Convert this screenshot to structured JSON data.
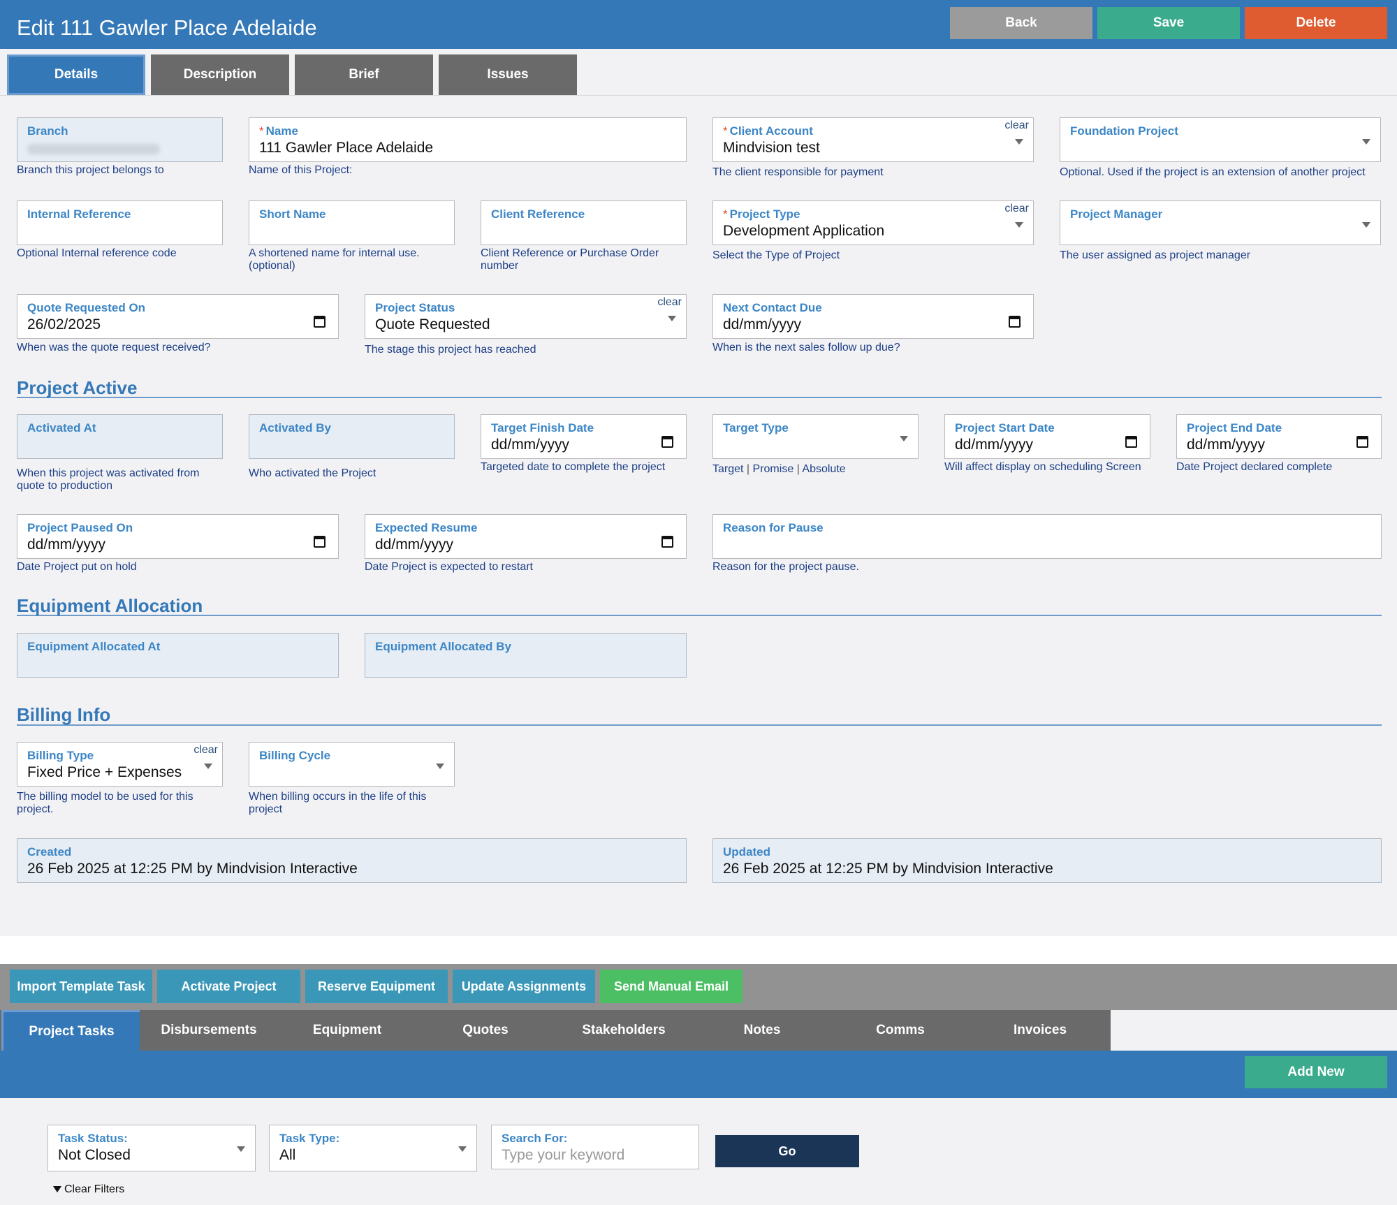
{
  "header": {
    "title": "Edit 111 Gawler Place Adelaide",
    "back_label": "Back",
    "save_label": "Save",
    "delete_label": "Delete"
  },
  "tabs": [
    "Details",
    "Description",
    "Brief",
    "Issues"
  ],
  "details": {
    "branch": {
      "label": "Branch",
      "value": "",
      "help": "Branch this project belongs to"
    },
    "name": {
      "label": "Name",
      "value": "111 Gawler Place Adelaide",
      "help": "Name of this Project:"
    },
    "client_account": {
      "label": "Client Account",
      "value": "Mindvision test",
      "help": "The client responsible for payment",
      "clear": "clear"
    },
    "foundation_project": {
      "label": "Foundation Project",
      "value": "",
      "help": "Optional. Used if the project is an extension of another project"
    },
    "internal_reference": {
      "label": "Internal Reference",
      "value": "",
      "help": "Optional Internal reference code"
    },
    "short_name": {
      "label": "Short Name",
      "value": "",
      "help": "A shortened name for internal use. (optional)"
    },
    "client_reference": {
      "label": "Client Reference",
      "value": "",
      "help": "Client Reference or Purchase Order number"
    },
    "project_type": {
      "label": "Project Type",
      "value": "Development Application",
      "help": "Select the Type of Project",
      "clear": "clear"
    },
    "project_manager": {
      "label": "Project Manager",
      "value": "",
      "help": "The user assigned as project manager"
    },
    "quote_requested_on": {
      "label": "Quote Requested On",
      "value": "26/02/2025",
      "help": "When was the quote request received?"
    },
    "project_status": {
      "label": "Project Status",
      "value": "Quote Requested",
      "help": "The stage this project has reached",
      "clear": "clear"
    },
    "next_contact_due": {
      "label": "Next Contact Due",
      "value": "dd/mm/yyyy",
      "help": "When is the next sales follow up due?"
    }
  },
  "project_active": {
    "heading": "Project Active",
    "activated_at": {
      "label": "Activated At",
      "value": "",
      "help": "When this project was activated from quote to production"
    },
    "activated_by": {
      "label": "Activated By",
      "value": "",
      "help": "Who activated the Project"
    },
    "target_finish_date": {
      "label": "Target Finish Date",
      "value": "dd/mm/yyyy",
      "help": "Targeted date to complete the project"
    },
    "target_type": {
      "label": "Target Type",
      "value": "",
      "help_options": [
        "Target",
        "Promise",
        "Absolute"
      ],
      "help_sep": "|"
    },
    "project_start_date": {
      "label": "Project Start Date",
      "value": "dd/mm/yyyy",
      "help": "Will affect display on scheduling Screen"
    },
    "project_end_date": {
      "label": "Project End Date",
      "value": "dd/mm/yyyy",
      "help": "Date Project declared complete"
    },
    "project_paused_on": {
      "label": "Project Paused On",
      "value": "dd/mm/yyyy",
      "help": "Date Project put on hold"
    },
    "expected_resume": {
      "label": "Expected Resume",
      "value": "dd/mm/yyyy",
      "help": "Date Project is expected to restart"
    },
    "reason_for_pause": {
      "label": "Reason for Pause",
      "value": "",
      "help": "Reason for the project pause."
    }
  },
  "equipment_allocation": {
    "heading": "Equipment Allocation",
    "allocated_at": {
      "label": "Equipment Allocated At",
      "value": ""
    },
    "allocated_by": {
      "label": "Equipment Allocated By",
      "value": ""
    }
  },
  "billing_info": {
    "heading": "Billing Info",
    "billing_type": {
      "label": "Billing Type",
      "value": "Fixed Price + Expenses",
      "help": "The billing model to be used for this project.",
      "clear": "clear"
    },
    "billing_cycle": {
      "label": "Billing Cycle",
      "value": "",
      "help": "When billing occurs in the life of this project"
    },
    "created": {
      "label": "Created",
      "value": "26 Feb 2025 at 12:25 PM by Mindvision Interactive"
    },
    "updated": {
      "label": "Updated",
      "value": "26 Feb 2025 at 12:25 PM by Mindvision Interactive"
    }
  },
  "actions": [
    "Import Template Task",
    "Activate Project",
    "Reserve Equipment",
    "Update Assignments",
    "Send Manual Email"
  ],
  "subtabs": [
    "Project Tasks",
    "Disbursements",
    "Equipment",
    "Quotes",
    "Stakeholders",
    "Notes",
    "Comms",
    "Invoices"
  ],
  "add_new_label": "Add New",
  "filters": {
    "task_status": {
      "label": "Task Status:",
      "value": "Not Closed"
    },
    "task_type": {
      "label": "Task Type:",
      "value": "All"
    },
    "search_for": {
      "label": "Search For:",
      "placeholder": "Type your keyword"
    },
    "go_label": "Go",
    "clear_filters_label": "Clear Filters"
  }
}
